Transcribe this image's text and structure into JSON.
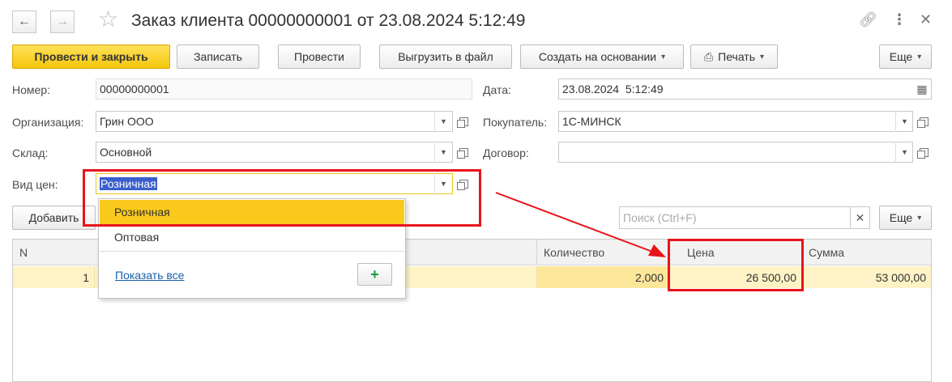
{
  "title": "Заказ клиента 00000000001 от 23.08.2024 5:12:49",
  "icons": {
    "back": "arrow-left-icon",
    "forward": "arrow-right-icon",
    "favorite": "star-icon",
    "link": "link-icon",
    "more": "kebab-icon",
    "close": "close-icon"
  },
  "toolbar": {
    "post_close": "Провести и закрыть",
    "save": "Записать",
    "post": "Провести",
    "export": "Выгрузить в файл",
    "create_based": "Создать на основании",
    "print": "Печать",
    "more": "Еще"
  },
  "form": {
    "number_label": "Номер:",
    "number_value": "00000000001",
    "date_label": "Дата:",
    "date_value": "23.08.2024  5:12:49",
    "org_label": "Организация:",
    "org_value": "Грин ООО",
    "buyer_label": "Покупатель:",
    "buyer_value": "1С-МИНСК",
    "warehouse_label": "Склад:",
    "warehouse_value": "Основной",
    "contract_label": "Договор:",
    "contract_value": "",
    "price_type_label": "Вид цен:",
    "price_type_value": "Розничная"
  },
  "table_toolbar": {
    "add": "Добавить",
    "search_placeholder": "Поиск (Ctrl+F)",
    "more": "Еще"
  },
  "table": {
    "columns": [
      "N",
      "Количество",
      "Цена",
      "Сумма"
    ],
    "rows": [
      {
        "n": "1",
        "qty": "2,000",
        "price": "26 500,00",
        "sum": "53 000,00"
      }
    ]
  },
  "dropdown": {
    "options": [
      "Розничная",
      "Оптовая"
    ],
    "selected": "Розничная",
    "show_all": "Показать все",
    "add_symbol": "+"
  },
  "colors": {
    "accent": "#f5c60b",
    "highlight_row": "#fdf3c7",
    "annotation": "#e8141b"
  }
}
